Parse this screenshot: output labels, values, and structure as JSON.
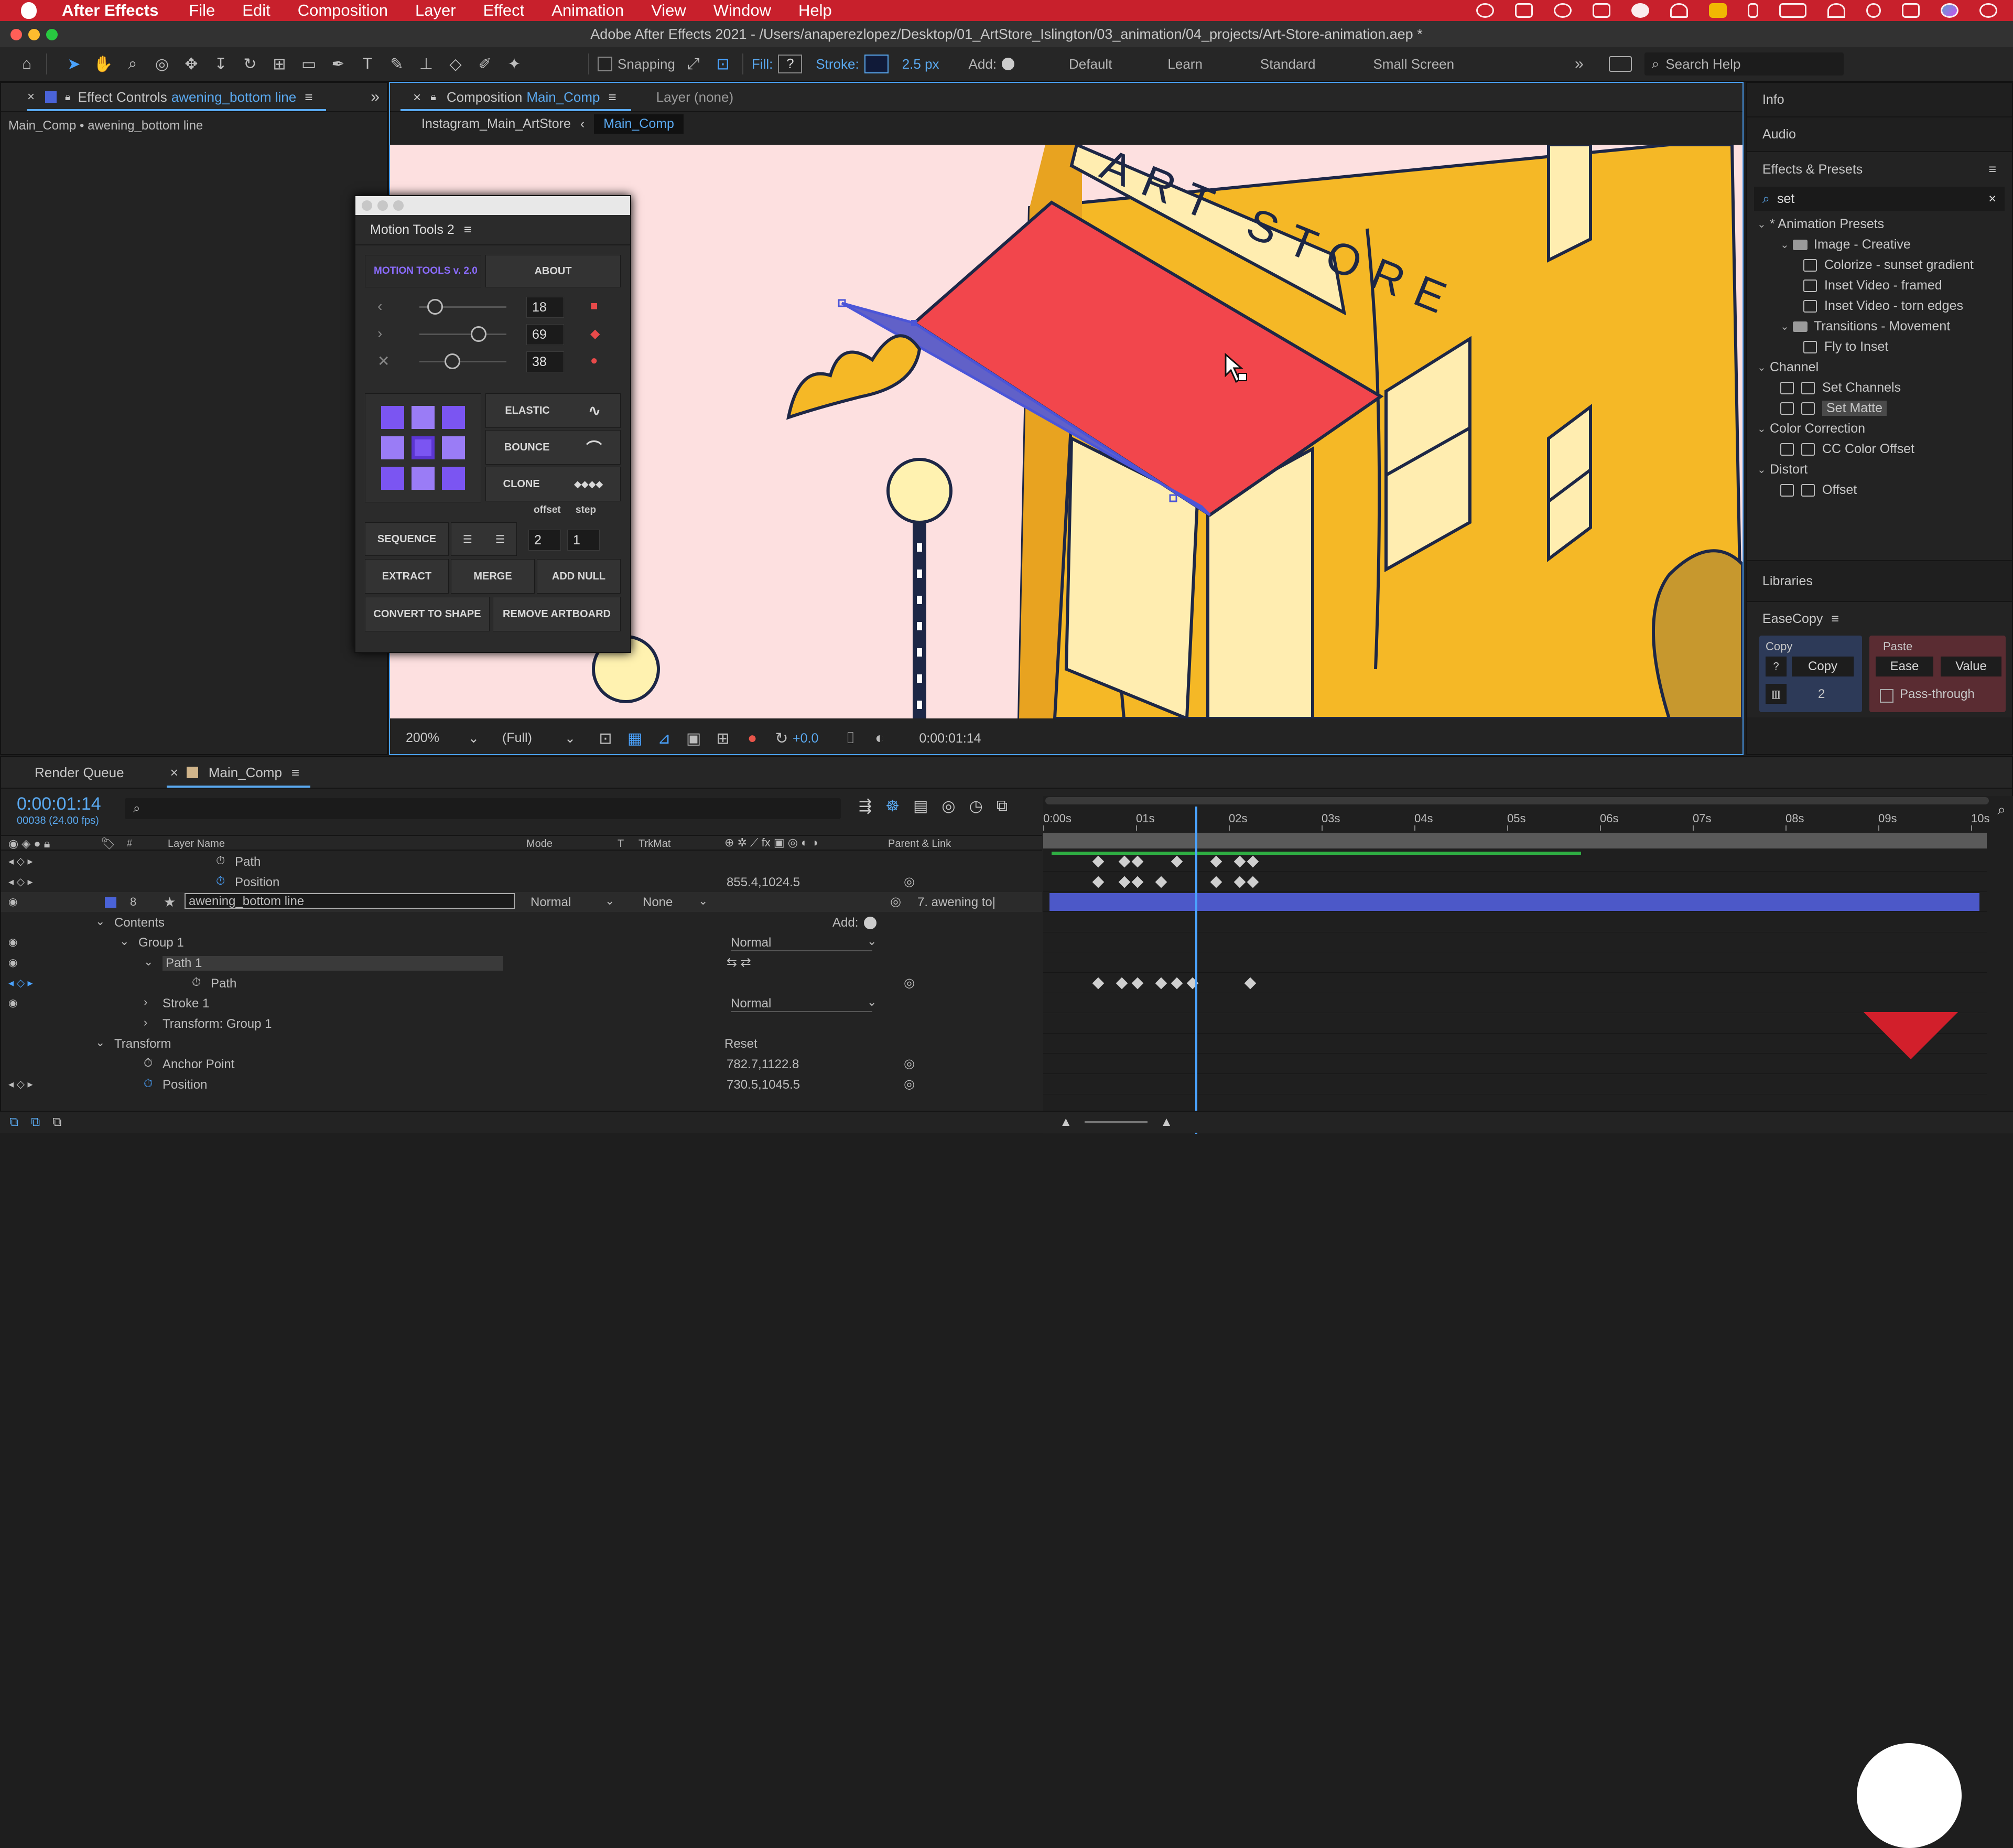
{
  "menubar": {
    "app": "After Effects",
    "items": [
      "File",
      "Edit",
      "Composition",
      "Layer",
      "Effect",
      "Animation",
      "View",
      "Window",
      "Help"
    ]
  },
  "window": {
    "title": "Adobe After Effects 2021 - /Users/anaperezlopez/Desktop/01_ArtStore_Islington/03_animation/04_projects/Art-Store-animation.aep *"
  },
  "toolbar": {
    "snapping": "Snapping",
    "fill_label": "Fill:",
    "fill_value": "?",
    "stroke_label": "Stroke:",
    "stroke_width": "2.5 px",
    "add_label": "Add:",
    "workspaces": [
      "Default",
      "Learn",
      "Standard",
      "Small Screen"
    ],
    "search_placeholder": "Search Help"
  },
  "effect_controls": {
    "tab_prefix": "Effect Controls",
    "tab_layer": "awening_bottom line",
    "breadcrumb": "Main_Comp • awening_bottom line"
  },
  "composition": {
    "tab_prefix": "Composition",
    "tab_comp": "Main_Comp",
    "layer_tab": "Layer (none)",
    "crumb_parent": "Instagram_Main_ArtStore",
    "crumb_current": "Main_Comp",
    "zoom": "200%",
    "resolution": "(Full)",
    "exposure": "+0.0",
    "timecode": "0:00:01:14",
    "sign_text": "ART STORE"
  },
  "motion_tools": {
    "title": "Motion Tools 2",
    "logo": "MOTION TOOLS v. 2.0",
    "about": "ABOUT",
    "slider_values": [
      "18",
      "69",
      "38"
    ],
    "slider_levels": [
      0.2,
      0.7,
      0.4
    ],
    "elastic": "ELASTIC",
    "bounce": "BOUNCE",
    "clone": "CLONE",
    "offset": "offset",
    "step": "step",
    "sequence": "SEQUENCE",
    "seq_values": [
      "2",
      "1"
    ],
    "extract": "EXTRACT",
    "merge": "MERGE",
    "add_null": "ADD NULL",
    "convert": "CONVERT TO SHAPE",
    "remove_artboard": "REMOVE ARTBOARD"
  },
  "right_panels": {
    "info": "Info",
    "audio": "Audio",
    "effects_presets": "Effects & Presets",
    "search_value": "set",
    "tree": [
      {
        "label": "* Animation Presets",
        "level": 0,
        "kind": "folder"
      },
      {
        "label": "Image - Creative",
        "level": 1,
        "kind": "dir"
      },
      {
        "label": "Colorize - sunset gradient",
        "level": 2,
        "kind": "preset"
      },
      {
        "label": "Inset Video - framed",
        "level": 2,
        "kind": "preset"
      },
      {
        "label": "Inset Video - torn edges",
        "level": 2,
        "kind": "preset"
      },
      {
        "label": "Transitions - Movement",
        "level": 1,
        "kind": "dir"
      },
      {
        "label": "Fly to Inset",
        "level": 2,
        "kind": "preset"
      },
      {
        "label": "Channel",
        "level": 0,
        "kind": "folder"
      },
      {
        "label": "Set Channels",
        "level": 1,
        "kind": "effect"
      },
      {
        "label": "Set Matte",
        "level": 1,
        "kind": "effect",
        "selected": true
      },
      {
        "label": "Color Correction",
        "level": 0,
        "kind": "folder"
      },
      {
        "label": "CC Color Offset",
        "level": 1,
        "kind": "effect"
      },
      {
        "label": "Distort",
        "level": 0,
        "kind": "folder"
      },
      {
        "label": "Offset",
        "level": 1,
        "kind": "effect"
      }
    ],
    "libraries": "Libraries",
    "easecopy": {
      "title": "EaseCopy",
      "copy_group": "Copy",
      "copy_btn": "Copy",
      "question": "?",
      "count": "2",
      "paste_group": "Paste",
      "ease_btn": "Ease",
      "value_btn": "Value",
      "passthrough": "Pass-through"
    }
  },
  "timeline": {
    "render_queue": "Render Queue",
    "comp_tab": "Main_Comp",
    "timecode": "0:00:01:14",
    "frame_info": "00038 (24.00 fps)",
    "col_layer_name": "Layer Name",
    "col_mode": "Mode",
    "col_t": "T",
    "col_trkmat": "TrkMat",
    "col_parent": "Parent & Link",
    "col_hash": "#",
    "ruler": [
      "0:00s",
      "01s",
      "02s",
      "03s",
      "04s",
      "05s",
      "06s",
      "07s",
      "08s",
      "09s",
      "10s"
    ],
    "playhead_seconds": 1.58,
    "rows": [
      {
        "name": "Path",
        "indent": 6
      },
      {
        "name": "Position",
        "indent": 6,
        "value": "855.4,1024.5"
      },
      {
        "name": "awening_bottom line",
        "indent": 0,
        "num": "8",
        "mode": "Normal",
        "trkmat": "None",
        "parent": "7. awening to|"
      },
      {
        "name": "Contents",
        "indent": 1,
        "add_label": "Add:"
      },
      {
        "name": "Group 1",
        "indent": 2,
        "mode": "Normal"
      },
      {
        "name": "Path 1",
        "indent": 3
      },
      {
        "name": "Path",
        "indent": 5
      },
      {
        "name": "Stroke 1",
        "indent": 3,
        "mode": "Normal"
      },
      {
        "name": "Transform: Group 1",
        "indent": 3
      },
      {
        "name": "Transform",
        "indent": 1,
        "reset": "Reset"
      },
      {
        "name": "Anchor Point",
        "indent": 3,
        "value": "782.7,1122.8"
      },
      {
        "name": "Position",
        "indent": 3,
        "value": "730.5,1045.5"
      }
    ]
  },
  "colors": {
    "accent_blue": "#4aa3ff",
    "menubar_red": "#c8202c",
    "awning_red": "#f2464c",
    "building_yellow": "#f5b826",
    "canvas_pink": "#fde0e0",
    "layer_bar_blue": "#4c58c8",
    "motion_purple": "#7b55f2"
  }
}
